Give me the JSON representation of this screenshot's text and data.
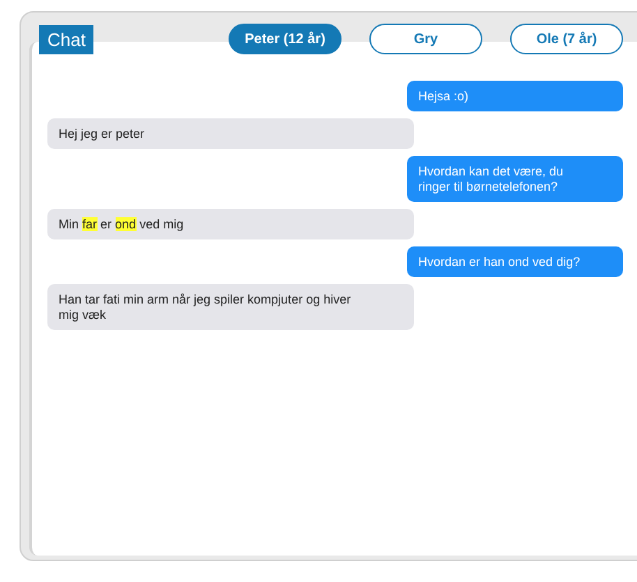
{
  "header": {
    "title": "Chat"
  },
  "tabs": [
    {
      "label": "Peter (12 år)",
      "selected": true
    },
    {
      "label": "Gry",
      "selected": false
    },
    {
      "label": "Ole (7 år)",
      "selected": false
    }
  ],
  "messages": [
    {
      "kind": "outgoing",
      "parts": [
        {
          "text": "Hejsa :o)",
          "highlighted": false
        }
      ]
    },
    {
      "kind": "incoming",
      "parts": [
        {
          "text": "Hej jeg er peter",
          "highlighted": false
        }
      ]
    },
    {
      "kind": "outgoing",
      "parts": [
        {
          "text": "Hvordan kan det være, du ringer til børnetelefonen?",
          "highlighted": false
        }
      ]
    },
    {
      "kind": "incoming",
      "parts": [
        {
          "text": "Min ",
          "highlighted": false
        },
        {
          "text": "far",
          "highlighted": true
        },
        {
          "text": " er ",
          "highlighted": false
        },
        {
          "text": "ond",
          "highlighted": true
        },
        {
          "text": " ved mig",
          "highlighted": false
        }
      ]
    },
    {
      "kind": "outgoing",
      "parts": [
        {
          "text": "Hvordan er han ond ved dig?",
          "highlighted": false
        }
      ]
    },
    {
      "kind": "incoming",
      "parts": [
        {
          "text": "Han tar fati min arm når jeg spiler kompjuter og hiver mig væk",
          "highlighted": false
        }
      ]
    }
  ]
}
